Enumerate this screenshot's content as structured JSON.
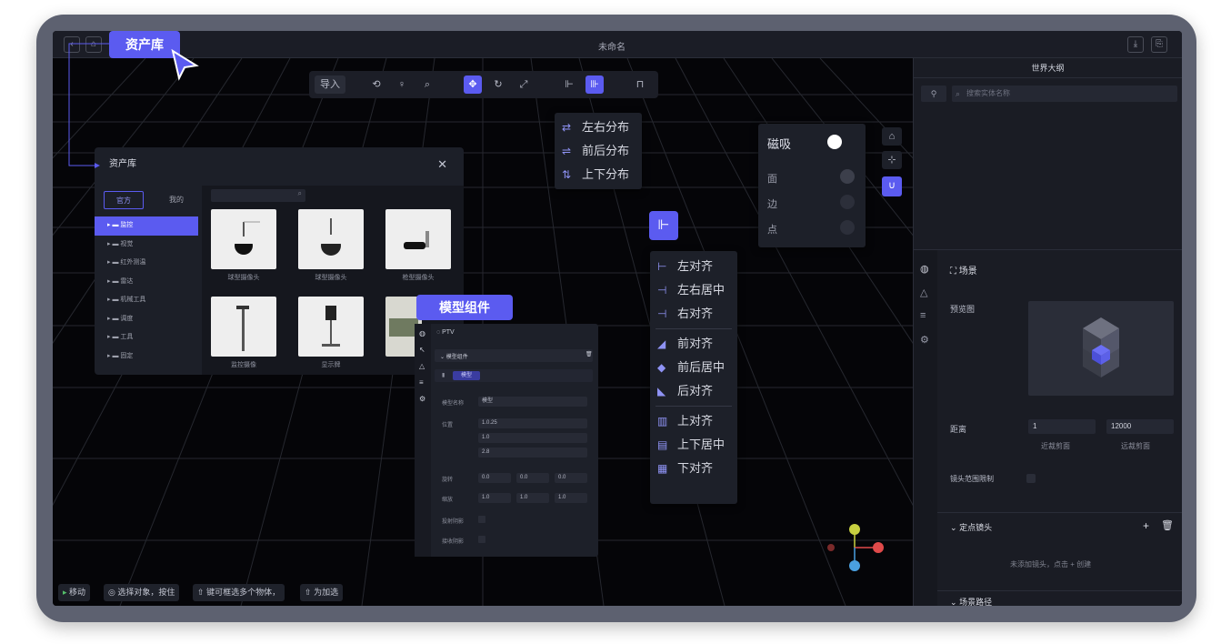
{
  "titlebar": {
    "title": "未命名",
    "back_icon": "back-icon",
    "download_icon": "download-icon",
    "export_icon": "export-icon"
  },
  "callouts": {
    "asset_library": "资产库",
    "model_component": "模型组件"
  },
  "toolbar": {
    "import_label": "导入"
  },
  "distribute_menu": {
    "items": [
      "左右分布",
      "前后分布",
      "上下分布"
    ]
  },
  "align_menu": {
    "items": [
      "左对齐",
      "左右居中",
      "右对齐",
      "前对齐",
      "前后居中",
      "后对齐",
      "上对齐",
      "上下居中",
      "下对齐"
    ]
  },
  "snap_panel": {
    "title": "磁吸",
    "rows": [
      "面",
      "边",
      "点"
    ]
  },
  "asset_library": {
    "title": "资产库",
    "tabs": [
      "官方",
      "我的"
    ],
    "tree": [
      "监控",
      "视觉",
      "红外测温",
      "雷达",
      "机械工具",
      "调度",
      "工具",
      "固定"
    ],
    "thumbnails": [
      {
        "label": "球型摄像头"
      },
      {
        "label": "球型摄像头"
      },
      {
        "label": "枪型摄像头"
      },
      {
        "label": "监控摄像"
      },
      {
        "label": "显示牌"
      }
    ]
  },
  "properties": {
    "tab": "PTV",
    "section": "模型组件",
    "sub_item": "模型",
    "rows": [
      "模型名称",
      "位置",
      "旋转",
      "缩放",
      "投射阴影",
      "接收阴影"
    ],
    "name_value": "模型",
    "pos_values": [
      "1.0.25",
      "1.0",
      "2.8"
    ],
    "rot_values": [
      "0.0",
      "0.0",
      "0.0"
    ],
    "scale_values": [
      "1.0",
      "1.0",
      "1.0"
    ]
  },
  "outliner": {
    "title": "世界大纲",
    "search_placeholder": "搜索实体名称"
  },
  "right_panel": {
    "section_title": "场景",
    "preview_label": "预览图",
    "range_label": "距离",
    "near_value": "1",
    "far_value": "12000",
    "near_label": "近裁剪面",
    "far_label": "远裁剪面",
    "lens_label": "镜头范围限制",
    "anchor_section": "定点镜头",
    "anchor_empty": "未添加镜头，点击 + 创建",
    "path_section": "场景路径"
  },
  "status_bar": {
    "items": [
      "移动",
      "选择对象，按住",
      "键可框选多个物体，",
      "为加选"
    ]
  },
  "colors": {
    "accent": "#5b5bf0",
    "bg": "#07080c",
    "panel": "#1d2029"
  }
}
